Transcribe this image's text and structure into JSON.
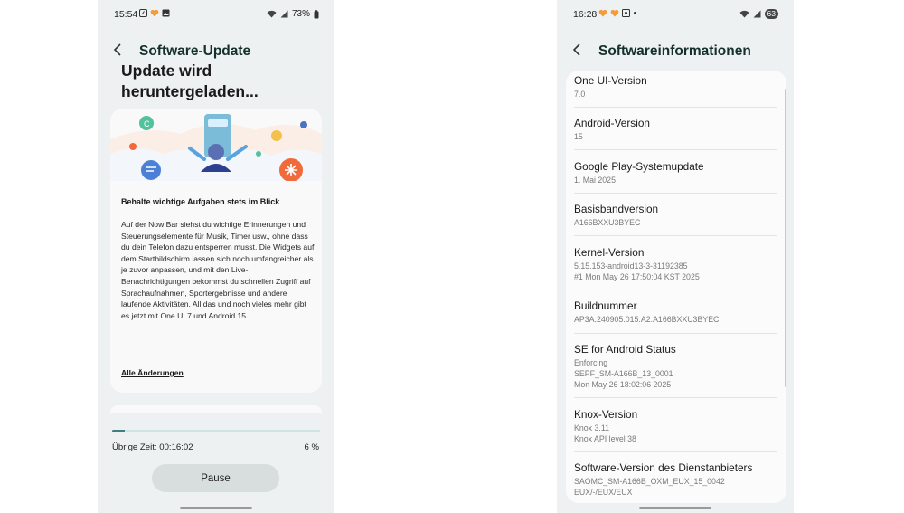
{
  "left": {
    "status": {
      "time": "15:54",
      "battery": "73%"
    },
    "header": {
      "title": "Software-Update"
    },
    "download_title_line1": "Update wird",
    "download_title_line2": "heruntergeladen...",
    "card": {
      "heading": "Behalte wichtige Aufgaben stets im Blick",
      "body": "Auf der Now Bar siehst du wichtige Erinnerungen und Steuerungselemente für Musik, Timer usw., ohne dass du dein Telefon dazu entsperren musst. Die Widgets auf dem Startbildschirm lassen sich noch umfangreicher als je zuvor anpassen, und mit den Live-Benachrichtigungen bekommst du schnellen Zugriff auf Sprachaufnahmen, Sportergebnisse und andere laufende Aktivitäten. All das und noch vieles mehr gibt es jetzt mit One UI 7 und Android 15.",
      "link": "Alle Änderungen"
    },
    "progress": {
      "fraction": 0.06,
      "remaining": "Übrige Zeit: 00:16:02",
      "percent": "6 %"
    },
    "pause_label": "Pause",
    "colors": {
      "accent": "#3d7f82",
      "background": "#edf1f1"
    }
  },
  "right": {
    "status": {
      "time": "16:28",
      "battery": "63"
    },
    "header": {
      "title": "Softwareinformationen"
    },
    "items": [
      {
        "title": "One UI-Version",
        "value": "7.0"
      },
      {
        "title": "Android-Version",
        "value": "15"
      },
      {
        "title": "Google Play-Systemupdate",
        "value": "1. Mai 2025"
      },
      {
        "title": "Basisbandversion",
        "value": "A166BXXU3BYEC"
      },
      {
        "title": "Kernel-Version",
        "value": "5.15.153-android13-3-31192385",
        "value2": "#1 Mon May 26 17:50:04 KST 2025"
      },
      {
        "title": "Buildnummer",
        "value": "AP3A.240905.015.A2.A166BXXU3BYEC"
      },
      {
        "title": "SE for Android Status",
        "value": "Enforcing",
        "value2": "SEPF_SM-A166B_13_0001",
        "value3": "Mon May 26 18:02:06 2025"
      },
      {
        "title": "Knox-Version",
        "value": "Knox 3.11",
        "value2": "Knox API level 38"
      },
      {
        "title": "Software-Version des Dienstanbieters",
        "value": "SAOMC_SM-A166B_OXM_EUX_15_0042",
        "value2": "EUX/-/EUX/EUX"
      }
    ]
  }
}
